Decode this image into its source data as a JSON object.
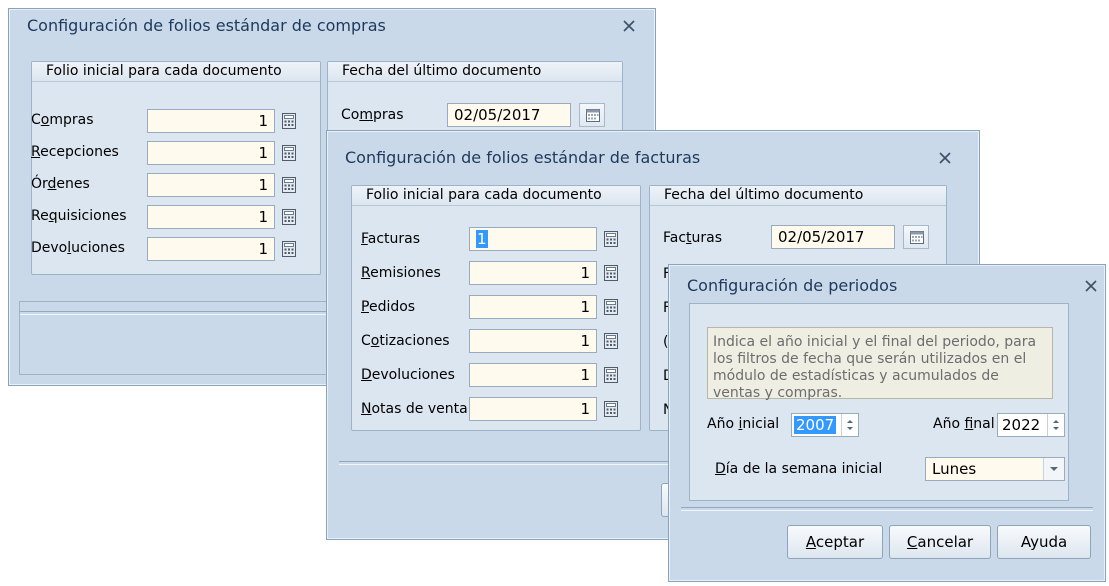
{
  "win1": {
    "title": "Configuración de folios estándar de compras",
    "group_left_title": "Folio inicial para cada documento",
    "group_right_title": "Fecha del último documento",
    "rows": [
      {
        "pre": "C",
        "key": "o",
        "post": "mpras",
        "value": "1"
      },
      {
        "pre": "",
        "key": "R",
        "post": "ecepciones",
        "value": "1"
      },
      {
        "pre": "Ór",
        "key": "d",
        "post": "enes",
        "value": "1"
      },
      {
        "pre": "Re",
        "key": "q",
        "post": "uisiciones",
        "value": "1"
      },
      {
        "pre": "Devo",
        "key": "l",
        "post": "uciones",
        "value": "1"
      }
    ],
    "date_rows": [
      {
        "pre": "Co",
        "key": "m",
        "post": "pras",
        "value": "02/05/2017"
      }
    ]
  },
  "win2": {
    "title": "Configuración de folios estándar de facturas",
    "group_left_title": "Folio inicial para cada documento",
    "group_right_title": "Fecha del último documento",
    "rows": [
      {
        "pre": "",
        "key": "F",
        "post": "acturas",
        "value": "1"
      },
      {
        "pre": "",
        "key": "R",
        "post": "emisiones",
        "value": "1"
      },
      {
        "pre": "",
        "key": "P",
        "post": "edidos",
        "value": "1"
      },
      {
        "pre": "C",
        "key": "o",
        "post": "tizaciones",
        "value": "1"
      },
      {
        "pre": "",
        "key": "D",
        "post": "evoluciones",
        "value": "1"
      },
      {
        "pre": "",
        "key": "N",
        "post": "otas de venta",
        "value": "1"
      }
    ],
    "date_rows": [
      {
        "pre": "Fac",
        "key": "t",
        "post": "uras",
        "value": "02/05/2017"
      }
    ],
    "partial_labels": [
      "F",
      "F",
      "(",
      "D",
      "N"
    ]
  },
  "win3": {
    "title": "Configuración de periodos",
    "info": "Indica el año inicial y el final del periodo, para los filtros de fecha que serán utilizados en el módulo de estadísticas y acumulados de ventas y compras.",
    "year_start": {
      "pre": "Año ",
      "key": "i",
      "post": "nicial",
      "value": "2007"
    },
    "year_end": {
      "pre": "Año ",
      "key": "f",
      "post": "inal",
      "value": "2022"
    },
    "weekday": {
      "pre": "",
      "key": "D",
      "post": "ía de la semana inicial",
      "value": "Lunes"
    },
    "buttons": {
      "accept": {
        "pre": "",
        "key": "A",
        "post": "ceptar"
      },
      "cancel": {
        "pre": "",
        "key": "C",
        "post": "ancelar"
      },
      "help": {
        "pre": "Ayuda",
        "key": "",
        "post": ""
      }
    }
  },
  "colors": {
    "window_bg": "#c9d9e9",
    "title_text": "#1e395b",
    "field_bg": "#fffaee",
    "selection": "#3399ff"
  }
}
